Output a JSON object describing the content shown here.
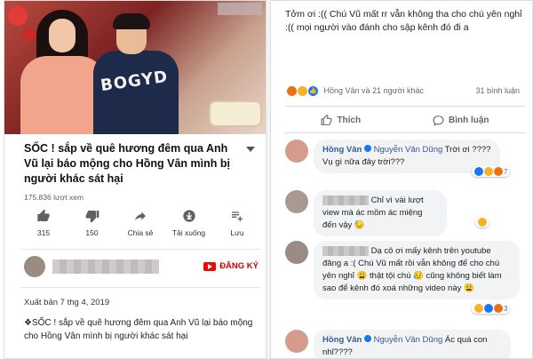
{
  "youtube": {
    "title": "SỐC ! sắp về quê hương  đêm qua Anh Vũ lại báo mộng cho Hồng Vân mình bị người khác sát hại",
    "views": "175.836 lượt xem",
    "shirt_text": "BOGYD",
    "actions": [
      {
        "icon": "thumbs-up-icon",
        "label": "315"
      },
      {
        "icon": "thumbs-down-icon",
        "label": "150"
      },
      {
        "icon": "share-icon",
        "label": "Chia sẻ"
      },
      {
        "icon": "download-icon",
        "label": "Tải xuống"
      },
      {
        "icon": "add-to-playlist-icon",
        "label": "Lưu"
      }
    ],
    "subscribe": "ĐĂNG KÝ",
    "published": "Xuất bản 7 thg 4, 2019",
    "description": "❖SỐC ! sắp về quê hương  đêm qua Anh Vũ lại báo mộng cho Hồng Vân mình bị người khác sát hại"
  },
  "facebook": {
    "post_text": "Tởm ơi :(( Chú Vũ mất rr vẫn không tha cho chú yên nghỉ :(( mọi người vào đánh cho sập kênh đó đi a",
    "reactions_summary": "Hồng Vân và 21 người khác",
    "comment_count": "31 bình luận",
    "like_label": "Thích",
    "comment_label": "Bình luận",
    "comments": [
      {
        "name": "Hồng Vân",
        "tag": "Nguyễn Văn Dũng",
        "text": "Trời ơi ???? Vụ gì nữa đây trời???",
        "reaction_count": "7"
      },
      {
        "name": "",
        "tag": "",
        "text": "Chỉ vì vài lượt view mà ác mồm ác miệng đến vậy 😓",
        "reaction_count": ""
      },
      {
        "name": "",
        "tag": "",
        "text": "Dạ cô ơi mấy kênh trên youtube đăng a :( Chú Vũ mất rồi vẫn không để cho chú yên nghỉ 😩 thật tội chú 😥 cũng không biết làm sao để kênh đó xoá những video này 😩",
        "reaction_count": "3"
      },
      {
        "name": "Hồng Vân",
        "tag": "Nguyễn Văn Dũng",
        "text": "Ác quá con nhỉ????",
        "reaction_count": ""
      }
    ],
    "colors": {
      "link": "#385898",
      "bubble": "#f2f3f5"
    }
  }
}
